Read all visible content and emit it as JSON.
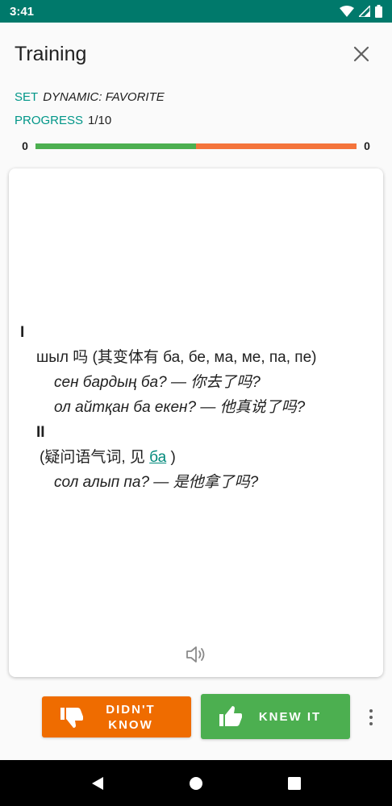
{
  "status_bar": {
    "time": "3:41"
  },
  "app_bar": {
    "title": "Training"
  },
  "info": {
    "set_label": "SET",
    "set_value": "DYNAMIC: FAVORITE",
    "progress_label": "PROGRESS",
    "progress_value": "1/10"
  },
  "progress_bar": {
    "known_count": "0",
    "unknown_count": "0",
    "known_fraction": 0.5
  },
  "card": {
    "entry": {
      "sense1_marker": "I",
      "sense1_definition": "шыл 吗 (其变体有 ба, бе, ма, ме, па, пе)",
      "sense1_examples": [
        "сен бардың ба? — 你去了吗?",
        "ол айтқан ба екен? — 他真说了吗?"
      ],
      "sense2_marker": "II",
      "sense2_definition_pre": "(疑问语气词, 见 ",
      "sense2_definition_link": "ба",
      "sense2_definition_post": " )",
      "sense2_examples": [
        "сол алып па? — 是他拿了吗?"
      ]
    }
  },
  "actions": {
    "didnt_know_label": "DIDN'T KNOW",
    "knew_it_label": "KNEW IT"
  },
  "colors": {
    "status_bar": "#00796b",
    "accent": "#009688",
    "known": "#4caf50",
    "unknown": "#f4743b",
    "didnt_know_button": "#ef6c00",
    "knew_it_button": "#4caf50"
  },
  "icons": {
    "wifi": "wifi-icon",
    "signal": "signal-icon",
    "battery": "battery-icon",
    "close": "close-icon",
    "speaker": "speaker-icon",
    "thumbs_down": "thumbs-down-icon",
    "thumbs_up": "thumbs-up-icon",
    "more": "more-vert-icon",
    "back": "back-icon",
    "home": "home-icon",
    "recents": "recents-icon"
  }
}
